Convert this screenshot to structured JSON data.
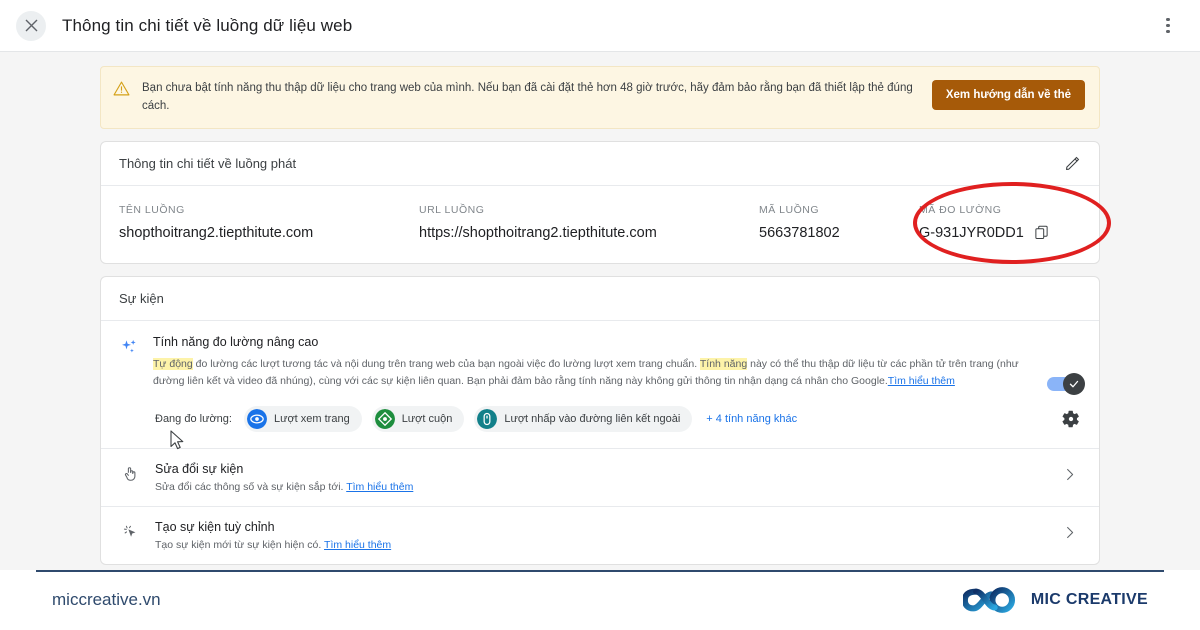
{
  "topbar": {
    "close_icon": "close-icon",
    "title": "Thông tin chi tiết về luồng dữ liệu web",
    "menu_icon": "more-vert-icon"
  },
  "banner": {
    "icon": "warning-triangle-icon",
    "text": "Bạn chưa bật tính năng thu thập dữ liệu cho trang web của mình. Nếu bạn đã cài đặt thẻ hơn 48 giờ trước, hãy đảm bảo rằng bạn đã thiết lập thẻ đúng cách.",
    "button_label": "Xem hướng dẫn về thẻ",
    "button_color": "#a65a09",
    "background": "#fdf6e3"
  },
  "stream_card": {
    "header": "Thông tin chi tiết về luồng phát",
    "edit_icon": "pencil-icon",
    "fields": [
      {
        "label": "TÊN LUỒNG",
        "value": "shopthoitrang2.tiepthitute.com"
      },
      {
        "label": "URL LUỒNG",
        "value": "https://shopthoitrang2.tiepthitute.com"
      },
      {
        "label": "MÃ LUỒNG",
        "value": "5663781802"
      },
      {
        "label": "MÃ ĐO LƯỜNG",
        "value": "G-931JYR0DD1"
      }
    ],
    "copy_icon": "copy-icon",
    "annotation_color": "#e02020"
  },
  "events_card": {
    "header": "Sự kiện",
    "enhanced": {
      "icon": "sparkles-icon",
      "title": "Tính năng đo lường nâng cao",
      "desc_highlight_1": "Tự động",
      "desc_part_1": " đo lường các lượt tương tác và nội dung trên trang web của bạn ngoài việc đo lường lượt xem trang chuẩn.",
      "desc_highlight_2": "Tính năng",
      "desc_part_2": " này có thể thu thập dữ liệu từ các phần tử trên trang (như đường liên kết và video đã nhúng), cùng với các sự kiện liên quan. Bạn phải đảm bảo rằng tính năng này không gửi thông tin nhận dạng cá nhân cho Google.",
      "learn_more": "Tìm hiểu thêm",
      "toggle_on": true,
      "toggle_color": "#8ab4f8"
    },
    "measuring": {
      "label": "Đang đo lường:",
      "chips": [
        {
          "label": "Lượt xem trang",
          "icon": "eye-icon",
          "color": "#1a73e8"
        },
        {
          "label": "Lượt cuộn",
          "icon": "scroll-icon",
          "color": "#1e8e3e"
        },
        {
          "label": "Lượt nhấp vào đường liên kết ngoài",
          "icon": "outbound-link-icon",
          "color": "#12808a"
        }
      ],
      "more_link": "+ 4 tính năng khác",
      "settings_icon": "gear-icon"
    },
    "rows": [
      {
        "icon": "tap-hand-icon",
        "title": "Sửa đổi sự kiện",
        "desc": "Sửa đổi các thông số và sự kiện sắp tới.",
        "learn_more": "Tìm hiểu thêm",
        "chevron": "chevron-right-icon"
      },
      {
        "icon": "cursor-sparkle-icon",
        "title": "Tạo sự kiện tuỳ chỉnh",
        "desc": "Tạo sự kiện mới từ sự kiện hiện có.",
        "learn_more": "Tìm hiểu thêm",
        "chevron": "chevron-right-icon"
      }
    ]
  },
  "footer": {
    "site": "miccreative.vn",
    "brand": "MIC CREATIVE",
    "logo_icon": "infinity-logo-icon",
    "accent": "#2f4a6d"
  }
}
